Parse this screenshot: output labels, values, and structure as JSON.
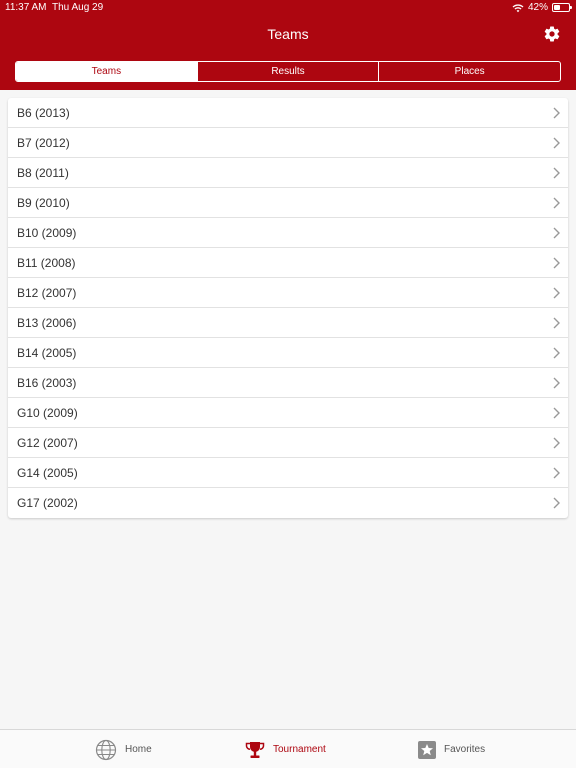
{
  "status_bar": {
    "time": "11:37 AM",
    "date": "Thu Aug 29",
    "battery": "42%",
    "battery_level": 0.42
  },
  "header": {
    "title": "Teams",
    "settings_icon": "gear-icon"
  },
  "tabs": [
    {
      "label": "Teams",
      "active": true
    },
    {
      "label": "Results",
      "active": false
    },
    {
      "label": "Places",
      "active": false
    }
  ],
  "teams": [
    {
      "label": "B6 (2013)"
    },
    {
      "label": "B7 (2012)"
    },
    {
      "label": "B8 (2011)"
    },
    {
      "label": "B9 (2010)"
    },
    {
      "label": "B10 (2009)"
    },
    {
      "label": "B11 (2008)"
    },
    {
      "label": "B12 (2007)"
    },
    {
      "label": "B13 (2006)"
    },
    {
      "label": "B14 (2005)"
    },
    {
      "label": "B16 (2003)"
    },
    {
      "label": "G10 (2009)"
    },
    {
      "label": "G12 (2007)"
    },
    {
      "label": "G14 (2005)"
    },
    {
      "label": "G17 (2002)"
    }
  ],
  "bottom_tabs": [
    {
      "label": "Home",
      "icon": "globe-icon",
      "active": false
    },
    {
      "label": "Tournament",
      "icon": "trophy-icon",
      "active": true
    },
    {
      "label": "Favorites",
      "icon": "star-icon",
      "active": false
    }
  ],
  "colors": {
    "brand": "#ad0610",
    "background": "#f6f6f6"
  }
}
